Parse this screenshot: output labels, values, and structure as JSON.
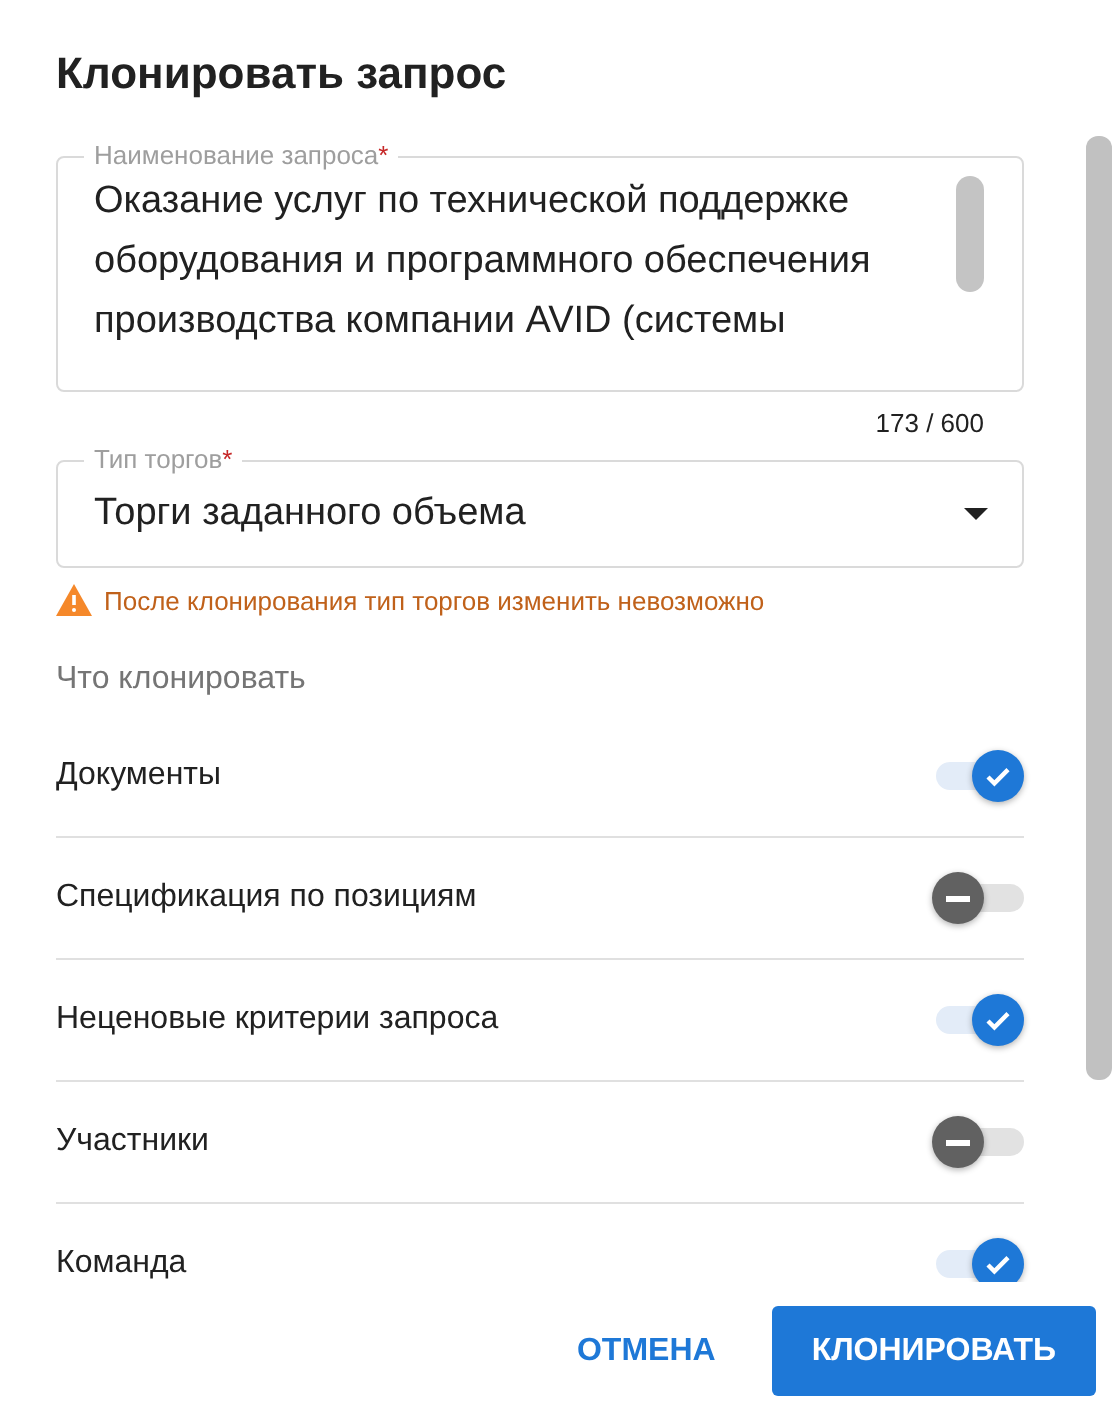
{
  "dialog": {
    "title": "Клонировать запрос"
  },
  "name_field": {
    "label": "Наименование запроса",
    "required_mark": "*",
    "value": "Оказание услуг по технической поддержке оборудования и программного обеспечения производства компании AVID (системы",
    "counter": "173 / 600"
  },
  "type_field": {
    "label": "Тип торгов",
    "required_mark": "*",
    "value": "Торги заданного объема",
    "warning": "После клонирования тип торгов изменить невозможно"
  },
  "section_title": "Что клонировать",
  "options": [
    {
      "label": "Документы",
      "on": true
    },
    {
      "label": "Спецификация по позициям",
      "on": false
    },
    {
      "label": "Неценовые критерии запроса",
      "on": true
    },
    {
      "label": "Участники",
      "on": false
    },
    {
      "label": "Команда",
      "on": true
    }
  ],
  "buttons": [
    {
      "label": "ОТМЕНА",
      "kind": "text"
    },
    {
      "label": "КЛОНИРОВАТЬ",
      "kind": "filled"
    }
  ]
}
